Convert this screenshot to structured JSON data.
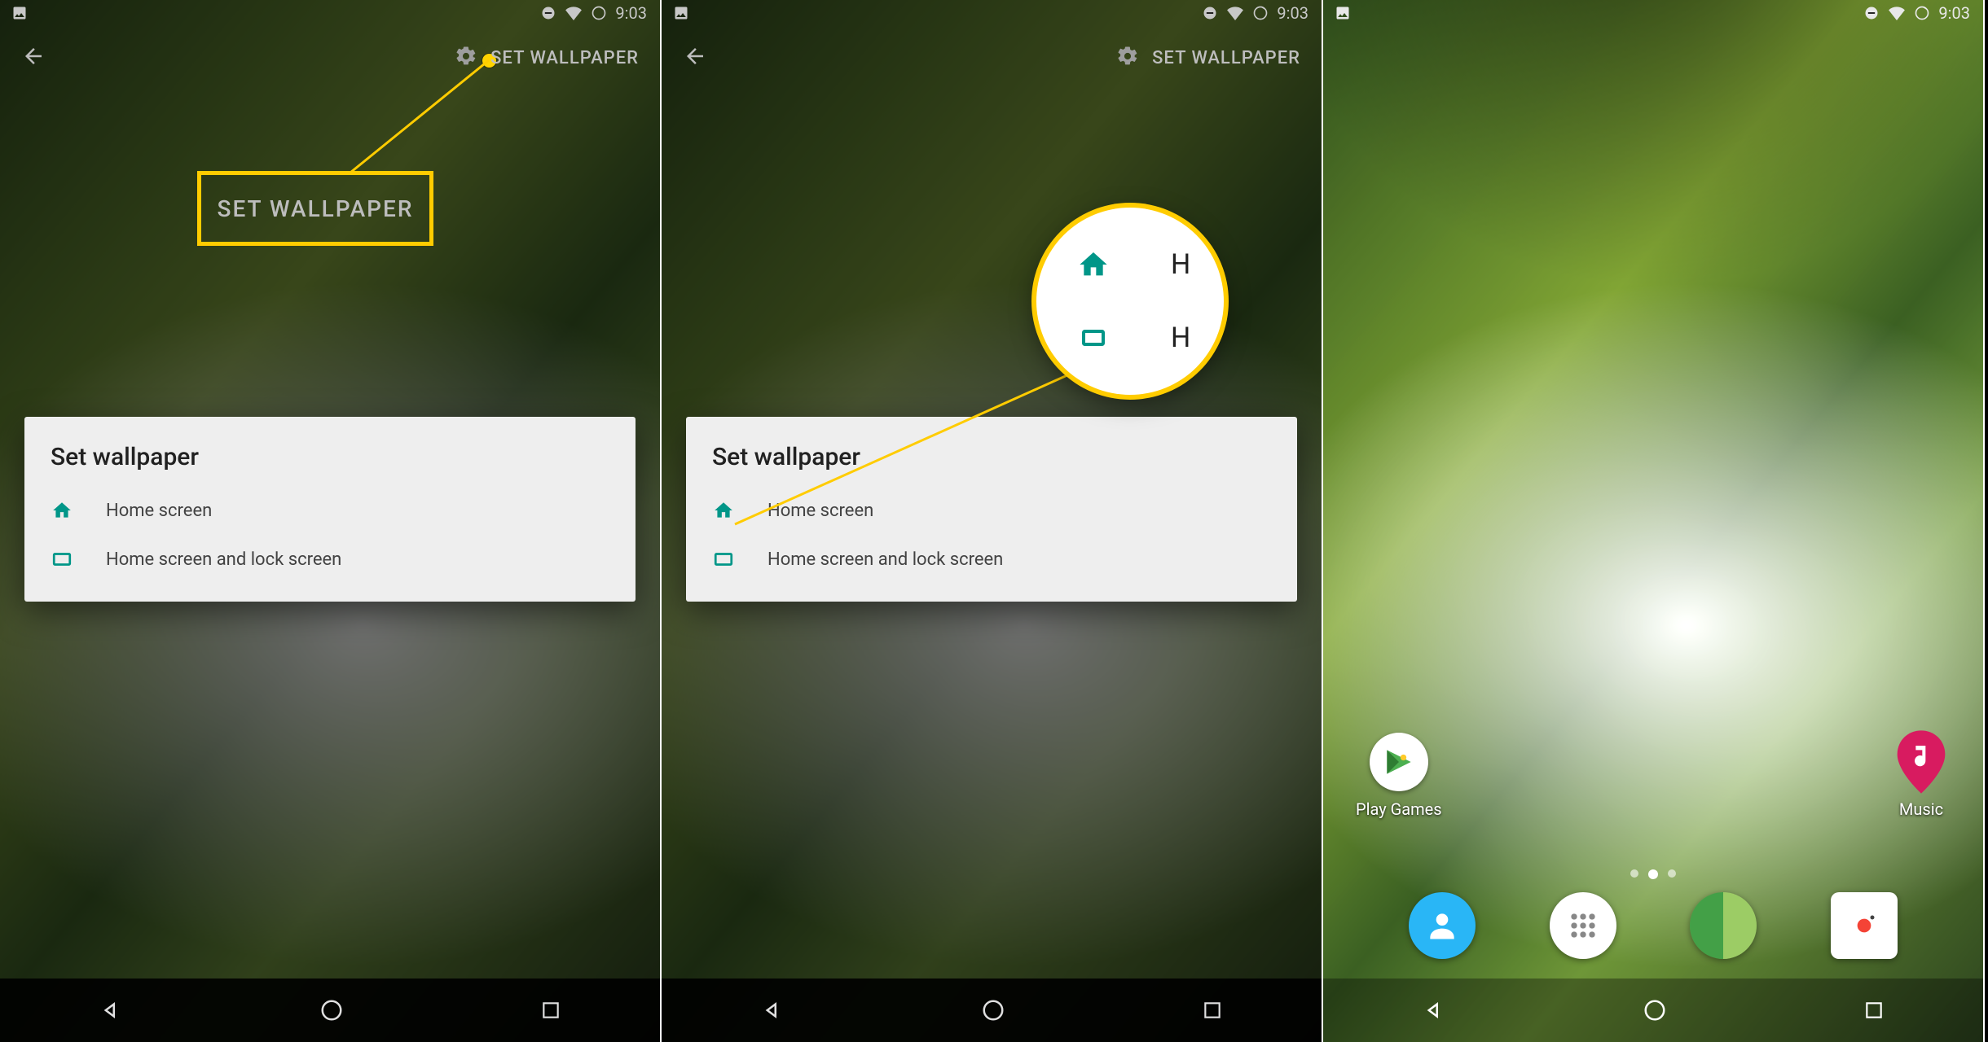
{
  "status": {
    "time": "9:03"
  },
  "appbar": {
    "set_wallpaper": "SET WALLPAPER"
  },
  "callout": {
    "label": "SET WALLPAPER"
  },
  "dialog": {
    "title": "Set wallpaper",
    "item_home": "Home screen",
    "item_both": "Home screen and lock screen"
  },
  "magnifier": {
    "letter1": "H",
    "letter2": "H"
  },
  "home": {
    "play_games": "Play Games",
    "music": "Music"
  }
}
